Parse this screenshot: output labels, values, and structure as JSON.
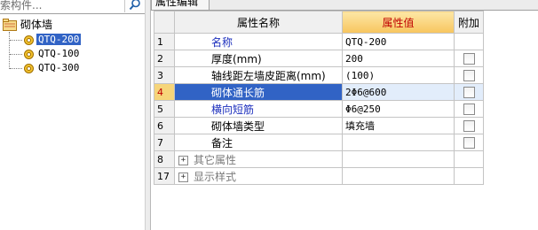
{
  "search": {
    "placeholder_text": "索构件...",
    "icon": "search-icon"
  },
  "tree": {
    "root_label": "砌体墙",
    "items": [
      {
        "label": "QTQ-200",
        "selected": true
      },
      {
        "label": "QTQ-100",
        "selected": false
      },
      {
        "label": "QTQ-300",
        "selected": false
      }
    ]
  },
  "tab": {
    "label": "属性编辑"
  },
  "table": {
    "headers": {
      "num": "",
      "name": "属性名称",
      "value": "属性值",
      "extra": "附加"
    },
    "rows": [
      {
        "num": "1",
        "name": "名称",
        "value": "QTQ-200"
      },
      {
        "num": "2",
        "name": "厚度(mm)",
        "value": "200"
      },
      {
        "num": "3",
        "name": "轴线距左墙皮距离(mm)",
        "value": "(100)"
      },
      {
        "num": "4",
        "name": "砌体通长筋",
        "value": "2Φ6@600"
      },
      {
        "num": "5",
        "name": "横向短筋",
        "value": "Φ6@250"
      },
      {
        "num": "6",
        "name": "砌体墙类型",
        "value": "填充墙"
      },
      {
        "num": "7",
        "name": "备注",
        "value": ""
      },
      {
        "num": "8",
        "name": "其它属性",
        "value": ""
      },
      {
        "num": "17",
        "name": "显示样式",
        "value": ""
      }
    ]
  },
  "colors": {
    "selection": "#3163c5",
    "header_accent": "#f7c55e",
    "header_text": "#c00000",
    "link_blue": "#1c2fbd"
  }
}
